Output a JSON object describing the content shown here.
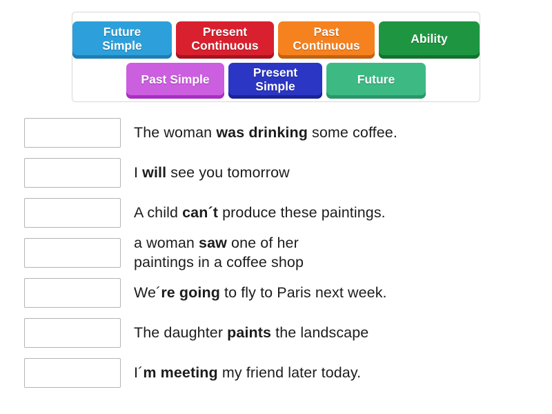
{
  "tray": {
    "rows": [
      [
        {
          "id": "future-simple",
          "label": "Future\nSimple",
          "color": "#2da0db",
          "shadow": "#1c7fb4"
        },
        {
          "id": "present-continuous",
          "label": "Present\nContinuous",
          "color": "#d9202f",
          "shadow": "#a8121f"
        },
        {
          "id": "past-continuous",
          "label": "Past\nContinuous",
          "color": "#f5821f",
          "shadow": "#c4620d"
        },
        {
          "id": "ability",
          "label": "Ability",
          "color": "#1e9641",
          "shadow": "#14712f"
        }
      ],
      [
        {
          "id": "past-simple",
          "label": "Past Simple",
          "color": "#cc5ee0",
          "shadow": "#a92ec2"
        },
        {
          "id": "present-simple",
          "label": "Present\nSimple",
          "color": "#2b36c4",
          "shadow": "#1a2396"
        },
        {
          "id": "future",
          "label": "Future",
          "color": "#3dba84",
          "shadow": "#29976a"
        }
      ]
    ]
  },
  "questions": [
    {
      "id": "q1",
      "before": "The woman ",
      "bold": "was drinking",
      "after": " some coffee."
    },
    {
      "id": "q2",
      "before": "I ",
      "bold": "will",
      "after": " see you tomorrow"
    },
    {
      "id": "q3",
      "before": "A child ",
      "bold": "can´t",
      "after": " produce these paintings."
    },
    {
      "id": "q4",
      "before": "a woman ",
      "bold": "saw",
      "after": " one of her\npaintings in a coffee shop"
    },
    {
      "id": "q5",
      "before": "We´",
      "bold": "re going",
      "after": " to fly to Paris next week."
    },
    {
      "id": "q6",
      "before": "The daughter ",
      "bold": "paints",
      "after": " the landscape"
    },
    {
      "id": "q7",
      "before": "I´",
      "bold": "m meeting",
      "after": " my friend later today."
    }
  ]
}
